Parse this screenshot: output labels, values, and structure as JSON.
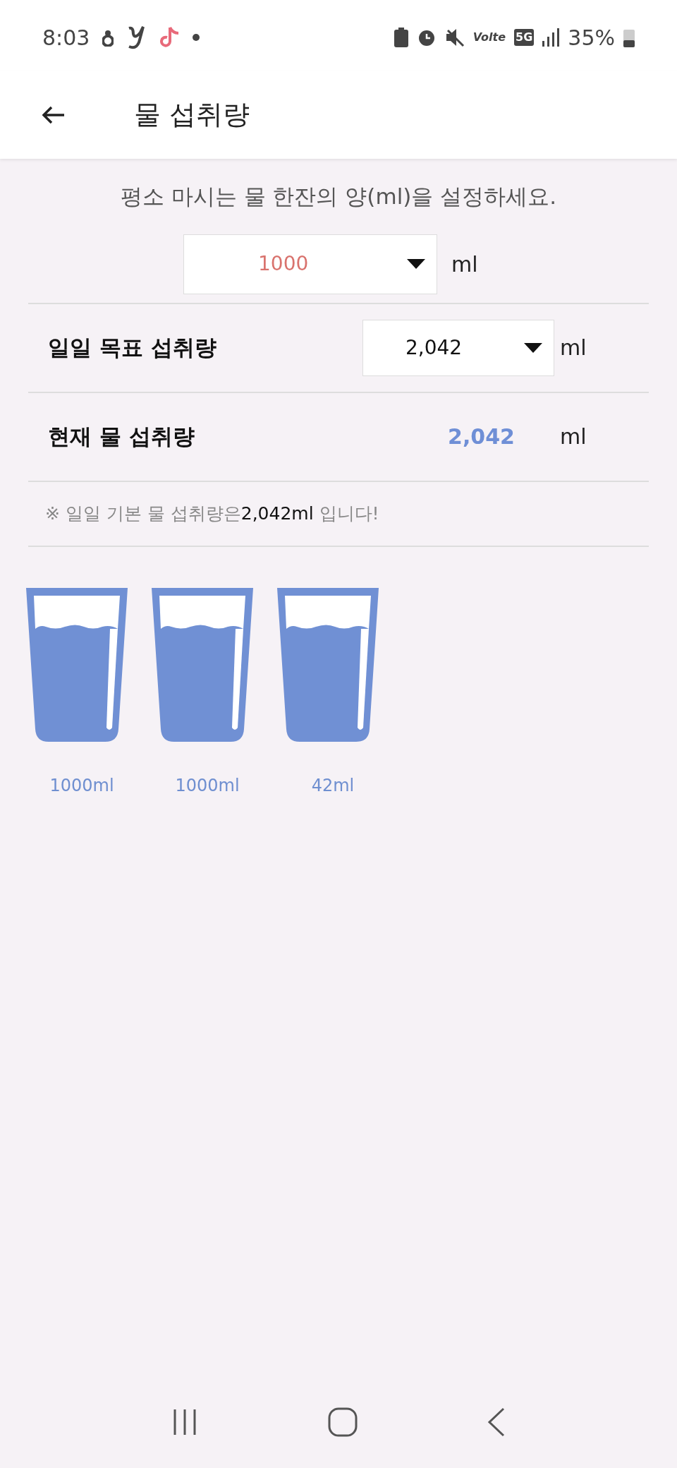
{
  "status_bar": {
    "time": "8:03",
    "volte": "Volte",
    "network": "5G",
    "battery": "35%"
  },
  "header": {
    "title": "물 섭취량"
  },
  "instruction": "평소 마시는 물 한잔의 양(ml)을 설정하세요.",
  "cup_size": {
    "value": "1000",
    "unit": "ml"
  },
  "rows": [
    {
      "kind": "dropdown",
      "label": "일일 목표 섭취량",
      "value": "2,042",
      "unit": "ml"
    },
    {
      "kind": "reading",
      "label": "현재 물 섭취량",
      "value": "2,042",
      "unit": "ml"
    }
  ],
  "note": {
    "before": "※ 일일 기본 물 섭취량은",
    "highlight": "2,042ml",
    "after": " 입니다!"
  },
  "glasses": [
    {
      "label": "1000ml"
    },
    {
      "label": "1000ml"
    },
    {
      "label": "42ml"
    }
  ]
}
